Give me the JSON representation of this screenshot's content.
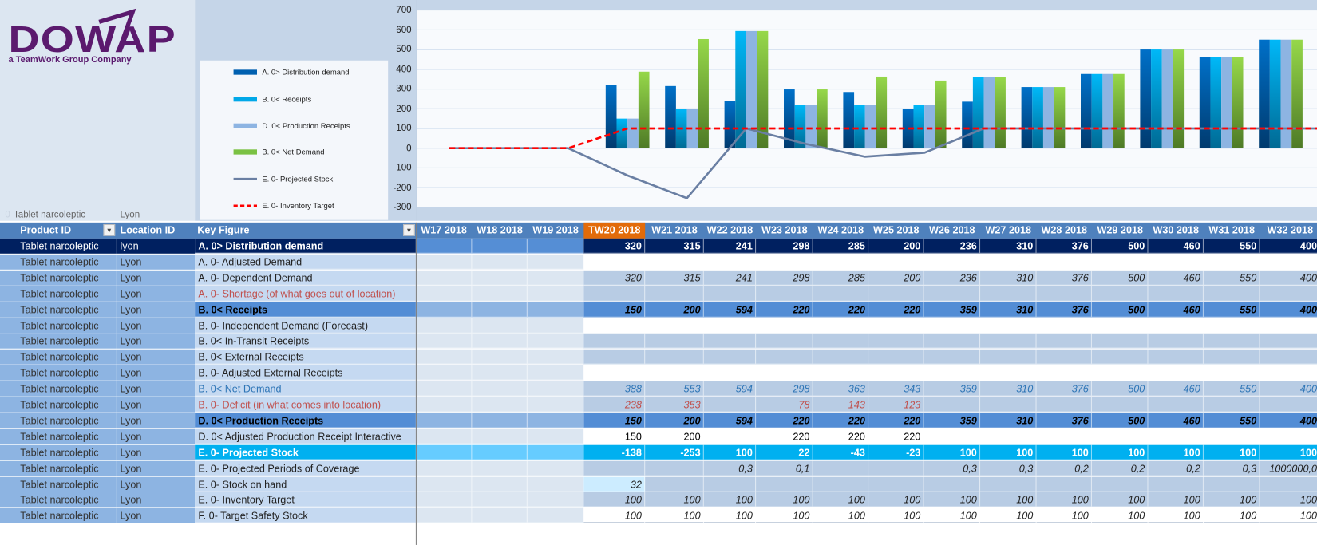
{
  "logo": {
    "wordmark": "DOWAP",
    "tagline": "a TeamWork Group Company",
    "color": "#5b1a6e"
  },
  "top_info": {
    "index": "0",
    "product": "Tablet narcoleptic",
    "location": "Lyon"
  },
  "legend": [
    {
      "label": "A. 0> Distribution demand",
      "color": "#0060b0",
      "kind": "bar"
    },
    {
      "label": "B. 0< Receipts",
      "color": "#00a8e8",
      "kind": "bar"
    },
    {
      "label": "D. 0< Production Receipts",
      "color": "#8db4e2",
      "kind": "bar"
    },
    {
      "label": "B. 0< Net Demand",
      "color": "#7ac143",
      "kind": "bar"
    },
    {
      "label": "E. 0- Projected Stock",
      "color": "#6a7fa3",
      "kind": "line"
    },
    {
      "label": "E. 0- Inventory Target",
      "color": "#ff0000",
      "kind": "dashed-line"
    }
  ],
  "chart_data": {
    "type": "bar",
    "categories": [
      "W17 2018",
      "W18 2018",
      "W19 2018",
      "TW20 2018",
      "W21 2018",
      "W22 2018",
      "W23 2018",
      "W24 2018",
      "W25 2018",
      "W26 2018",
      "W27 2018",
      "W28 2018",
      "W29 2018",
      "W30 2018",
      "W31 2018",
      "W32 2018"
    ],
    "ylim": [
      -300,
      700
    ],
    "yticks": [
      700,
      600,
      500,
      400,
      300,
      200,
      100,
      0,
      -100,
      -200,
      -300
    ],
    "grid": true,
    "legend_position": "left",
    "series": [
      {
        "name": "A. 0> Distribution demand",
        "type": "bar",
        "values": [
          null,
          null,
          null,
          320,
          315,
          241,
          298,
          285,
          200,
          236,
          310,
          376,
          500,
          460,
          550,
          400
        ]
      },
      {
        "name": "B. 0< Receipts",
        "type": "bar",
        "values": [
          null,
          null,
          null,
          150,
          200,
          594,
          220,
          220,
          220,
          359,
          310,
          376,
          500,
          460,
          550,
          400
        ]
      },
      {
        "name": "D. 0< Production Receipts",
        "type": "bar",
        "values": [
          null,
          null,
          null,
          150,
          200,
          594,
          220,
          220,
          220,
          359,
          310,
          376,
          500,
          460,
          550,
          400
        ]
      },
      {
        "name": "B. 0< Net Demand",
        "type": "bar",
        "values": [
          null,
          null,
          null,
          388,
          553,
          594,
          298,
          363,
          343,
          359,
          310,
          376,
          500,
          460,
          550,
          400
        ]
      },
      {
        "name": "E. 0- Projected Stock",
        "type": "line",
        "values": [
          0,
          0,
          0,
          -138,
          -253,
          100,
          22,
          -43,
          -23,
          100,
          100,
          100,
          100,
          100,
          100,
          100
        ]
      },
      {
        "name": "E. 0- Inventory Target",
        "type": "dashed-line",
        "values": [
          0,
          0,
          0,
          100,
          100,
          100,
          100,
          100,
          100,
          100,
          100,
          100,
          100,
          100,
          100,
          100
        ]
      }
    ]
  },
  "table": {
    "headers": {
      "product": "Product ID",
      "location": "Location ID",
      "key_figure": "Key Figure"
    },
    "current_week_color": "#e26b0a",
    "weeks": [
      "W17 2018",
      "W18 2018",
      "W19 2018",
      "TW20 2018",
      "W21 2018",
      "W22 2018",
      "W23 2018",
      "W24 2018",
      "W25 2018",
      "W26 2018",
      "W27 2018",
      "W28 2018",
      "W29 2018",
      "W30 2018",
      "W31 2018",
      "W32 2018"
    ],
    "rows": [
      {
        "product": "Tablet narcoleptic",
        "location": "lyon",
        "key": "A. 0> Distribution demand",
        "values": [
          "",
          "",
          "",
          "320",
          "315",
          "241",
          "298",
          "285",
          "200",
          "236",
          "310",
          "376",
          "500",
          "460",
          "550",
          "400"
        ]
      },
      {
        "product": "Tablet narcoleptic",
        "location": "Lyon",
        "key": "A. 0- Adjusted Demand",
        "values": [
          "",
          "",
          "",
          "",
          "",
          "",
          "",
          "",
          "",
          "",
          "",
          "",
          "",
          "",
          "",
          ""
        ]
      },
      {
        "product": "Tablet narcoleptic",
        "location": "Lyon",
        "key": "A. 0- Dependent Demand",
        "values": [
          "",
          "",
          "",
          "320",
          "315",
          "241",
          "298",
          "285",
          "200",
          "236",
          "310",
          "376",
          "500",
          "460",
          "550",
          "400"
        ]
      },
      {
        "product": "Tablet narcoleptic",
        "location": "Lyon",
        "key": "A. 0- Shortage (of what goes out of location)",
        "values": [
          "",
          "",
          "",
          "",
          "",
          "",
          "",
          "",
          "",
          "",
          "",
          "",
          "",
          "",
          "",
          ""
        ]
      },
      {
        "product": "Tablet narcoleptic",
        "location": "Lyon",
        "key": "B. 0< Receipts",
        "values": [
          "",
          "",
          "",
          "150",
          "200",
          "594",
          "220",
          "220",
          "220",
          "359",
          "310",
          "376",
          "500",
          "460",
          "550",
          "400"
        ]
      },
      {
        "product": "Tablet narcoleptic",
        "location": "Lyon",
        "key": "B. 0- Independent Demand (Forecast)",
        "values": [
          "",
          "",
          "",
          "",
          "",
          "",
          "",
          "",
          "",
          "",
          "",
          "",
          "",
          "",
          "",
          ""
        ]
      },
      {
        "product": "Tablet narcoleptic",
        "location": "Lyon",
        "key": "B. 0< In-Transit Receipts",
        "values": [
          "",
          "",
          "",
          "",
          "",
          "",
          "",
          "",
          "",
          "",
          "",
          "",
          "",
          "",
          "",
          ""
        ]
      },
      {
        "product": "Tablet narcoleptic",
        "location": "Lyon",
        "key": "B. 0< External Receipts",
        "values": [
          "",
          "",
          "",
          "",
          "",
          "",
          "",
          "",
          "",
          "",
          "",
          "",
          "",
          "",
          "",
          ""
        ]
      },
      {
        "product": "Tablet narcoleptic",
        "location": "Lyon",
        "key": "B. 0- Adjusted External Receipts",
        "values": [
          "",
          "",
          "",
          "",
          "",
          "",
          "",
          "",
          "",
          "",
          "",
          "",
          "",
          "",
          "",
          ""
        ]
      },
      {
        "product": "Tablet narcoleptic",
        "location": "Lyon",
        "key": "B. 0< Net Demand",
        "values": [
          "",
          "",
          "",
          "388",
          "553",
          "594",
          "298",
          "363",
          "343",
          "359",
          "310",
          "376",
          "500",
          "460",
          "550",
          "400"
        ]
      },
      {
        "product": "Tablet narcoleptic",
        "location": "Lyon",
        "key": "B. 0- Deficit (in what comes into location)",
        "values": [
          "",
          "",
          "",
          "238",
          "353",
          "",
          "78",
          "143",
          "123",
          "",
          "",
          "",
          "",
          "",
          "",
          ""
        ]
      },
      {
        "product": "Tablet narcoleptic",
        "location": "Lyon",
        "key": "D. 0< Production Receipts",
        "values": [
          "",
          "",
          "",
          "150",
          "200",
          "594",
          "220",
          "220",
          "220",
          "359",
          "310",
          "376",
          "500",
          "460",
          "550",
          "400"
        ]
      },
      {
        "product": "Tablet narcoleptic",
        "location": "Lyon",
        "key": "D. 0< Adjusted Production Receipt Interactive",
        "values": [
          "",
          "",
          "",
          "150",
          "200",
          "",
          "220",
          "220",
          "220",
          "",
          "",
          "",
          "",
          "",
          "",
          ""
        ]
      },
      {
        "product": "Tablet narcoleptic",
        "location": "Lyon",
        "key": "E. 0- Projected Stock",
        "values": [
          "",
          "",
          "",
          "-138",
          "-253",
          "100",
          "22",
          "-43",
          "-23",
          "100",
          "100",
          "100",
          "100",
          "100",
          "100",
          "100"
        ]
      },
      {
        "product": "Tablet narcoleptic",
        "location": "Lyon",
        "key": "E. 0- Projected Periods of Coverage",
        "values": [
          "",
          "",
          "",
          "",
          "",
          "0,3",
          "0,1",
          "",
          "",
          "0,3",
          "0,3",
          "0,2",
          "0,2",
          "0,2",
          "0,3",
          "1000000,0"
        ]
      },
      {
        "product": "Tablet narcoleptic",
        "location": "Lyon",
        "key": "E. 0- Stock on hand",
        "values": [
          "",
          "",
          "",
          "32",
          "",
          "",
          "",
          "",
          "",
          "",
          "",
          "",
          "",
          "",
          "",
          ""
        ]
      },
      {
        "product": "Tablet narcoleptic",
        "location": "Lyon",
        "key": "E. 0- Inventory Target",
        "values": [
          "",
          "",
          "",
          "100",
          "100",
          "100",
          "100",
          "100",
          "100",
          "100",
          "100",
          "100",
          "100",
          "100",
          "100",
          "100"
        ]
      },
      {
        "product": "Tablet narcoleptic",
        "location": "Lyon",
        "key": "F. 0- Target Safety Stock",
        "values": [
          "",
          "",
          "",
          "100",
          "100",
          "100",
          "100",
          "100",
          "100",
          "100",
          "100",
          "100",
          "100",
          "100",
          "100",
          "100"
        ]
      }
    ]
  }
}
